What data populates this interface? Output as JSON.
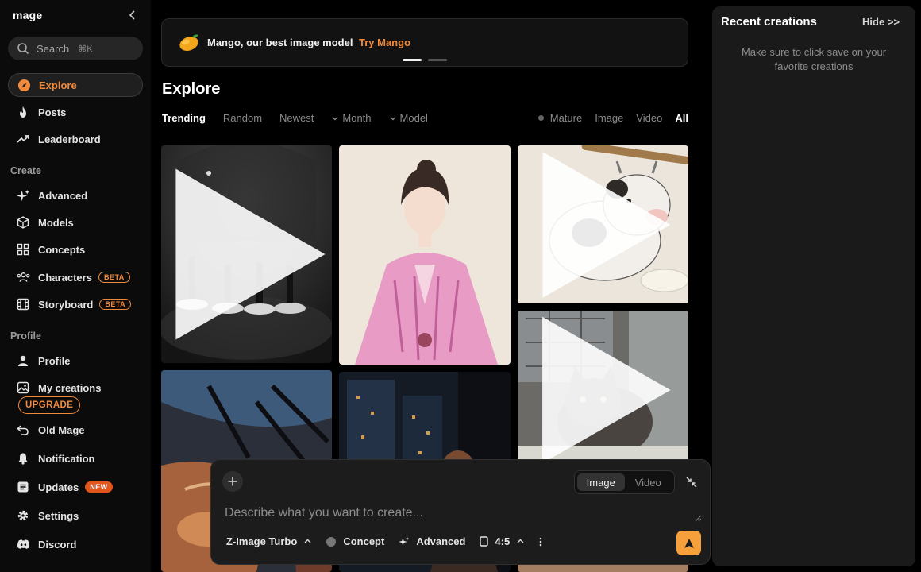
{
  "sidebar": {
    "logo": "mage",
    "search": {
      "label": "Search",
      "shortcut": "⌘K"
    },
    "items": [
      {
        "label": "Explore",
        "icon": "compass-icon"
      },
      {
        "label": "Posts",
        "icon": "flame-icon"
      },
      {
        "label": "Leaderboard",
        "icon": "trending-icon"
      },
      {
        "label": "Advanced",
        "icon": "sparkles-icon"
      },
      {
        "label": "Models",
        "icon": "cube-icon"
      },
      {
        "label": "Concepts",
        "icon": "grid-icon"
      },
      {
        "label": "Characters",
        "icon": "users-icon",
        "badge": "BETA"
      },
      {
        "label": "Storyboard",
        "icon": "film-icon",
        "badge": "BETA"
      },
      {
        "label": "Profile",
        "icon": "user-icon"
      },
      {
        "label": "My creations",
        "icon": "image-icon"
      },
      {
        "label": "Old Mage",
        "icon": "undo-icon"
      },
      {
        "label": "Notification",
        "icon": "bell-icon"
      },
      {
        "label": "Updates",
        "icon": "news-icon",
        "badge": "NEW"
      },
      {
        "label": "Settings",
        "icon": "gear-icon"
      },
      {
        "label": "Discord",
        "icon": "discord-icon"
      }
    ],
    "sections": {
      "create": "Create",
      "profile": "Profile"
    },
    "upgrade": "UPGRADE"
  },
  "banner": {
    "message": "Mango, our best image model",
    "cta": "Try Mango"
  },
  "explore": {
    "title": "Explore",
    "tabs": [
      "Trending",
      "Random",
      "Newest",
      "Month",
      "Model"
    ],
    "filters": [
      "Mature",
      "Image",
      "Video",
      "All"
    ]
  },
  "composer": {
    "modes": [
      "Image",
      "Video"
    ],
    "placeholder": "Describe what you want to create...",
    "model": "Z-Image Turbo",
    "concept": "Concept",
    "advanced": "Advanced",
    "ratio": "4:5"
  },
  "recent": {
    "title": "Recent creations",
    "hide": "Hide >>",
    "hint": "Make sure to click save on your favorite creations"
  },
  "colors": {
    "accent": "#f08a3c",
    "send": "#f5a03a",
    "new_badge": "#e2561c"
  }
}
